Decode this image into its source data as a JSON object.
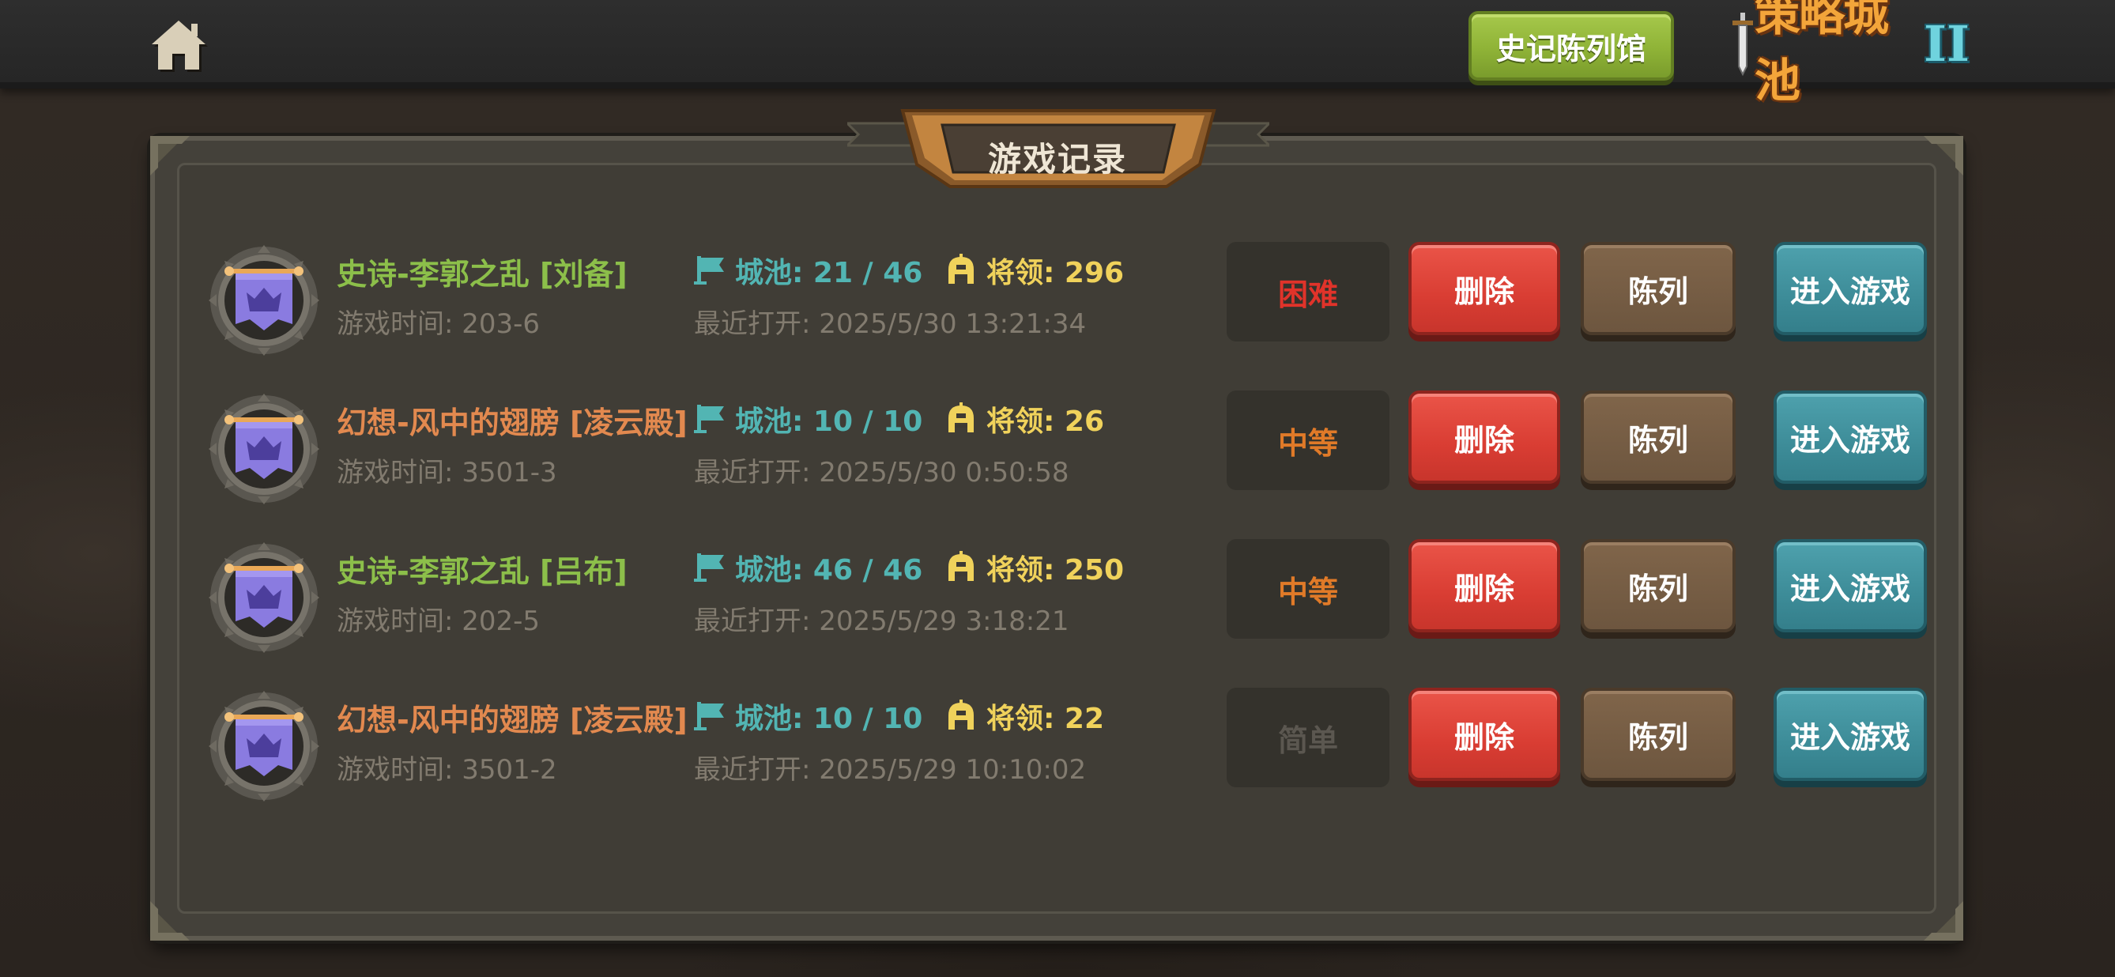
{
  "header": {
    "museum_button": "史记陈列馆",
    "logo_text": "策略城池",
    "logo_numeral": "II"
  },
  "panel": {
    "title": "游戏记录"
  },
  "colors": {
    "epic_name": "#8cbf4a",
    "fantasy_name": "#e2894f",
    "hard": "#e0332a",
    "medium": "#e07a28",
    "easy": "#5b5750"
  },
  "records": [
    {
      "name": "史诗-李郭之乱 [刘备]",
      "name_color": "#8cbf4a",
      "game_time": "游戏时间: 203-6",
      "cities": "城池: 21 / 46",
      "generals": "将领: 296",
      "recent": "最近打开: 2025/5/30 13:21:34",
      "difficulty": "困难",
      "difficulty_color": "#e0332a",
      "delete": "删除",
      "arrange": "陈列",
      "enter": "进入游戏"
    },
    {
      "name": "幻想-风中的翅膀 [凌云殿]",
      "name_color": "#e2894f",
      "game_time": "游戏时间: 3501-3",
      "cities": "城池: 10 / 10",
      "generals": "将领: 26",
      "recent": "最近打开: 2025/5/30 0:50:58",
      "difficulty": "中等",
      "difficulty_color": "#e07a28",
      "delete": "删除",
      "arrange": "陈列",
      "enter": "进入游戏"
    },
    {
      "name": "史诗-李郭之乱 [吕布]",
      "name_color": "#8cbf4a",
      "game_time": "游戏时间: 202-5",
      "cities": "城池: 46 / 46",
      "generals": "将领: 250",
      "recent": "最近打开: 2025/5/29 3:18:21",
      "difficulty": "中等",
      "difficulty_color": "#e07a28",
      "delete": "删除",
      "arrange": "陈列",
      "enter": "进入游戏"
    },
    {
      "name": "幻想-风中的翅膀 [凌云殿]",
      "name_color": "#e2894f",
      "game_time": "游戏时间: 3501-2",
      "cities": "城池: 10 / 10",
      "generals": "将领: 22",
      "recent": "最近打开: 2025/5/29 10:10:02",
      "difficulty": "简单",
      "difficulty_color": "#5b5750",
      "delete": "删除",
      "arrange": "陈列",
      "enter": "进入游戏"
    }
  ]
}
